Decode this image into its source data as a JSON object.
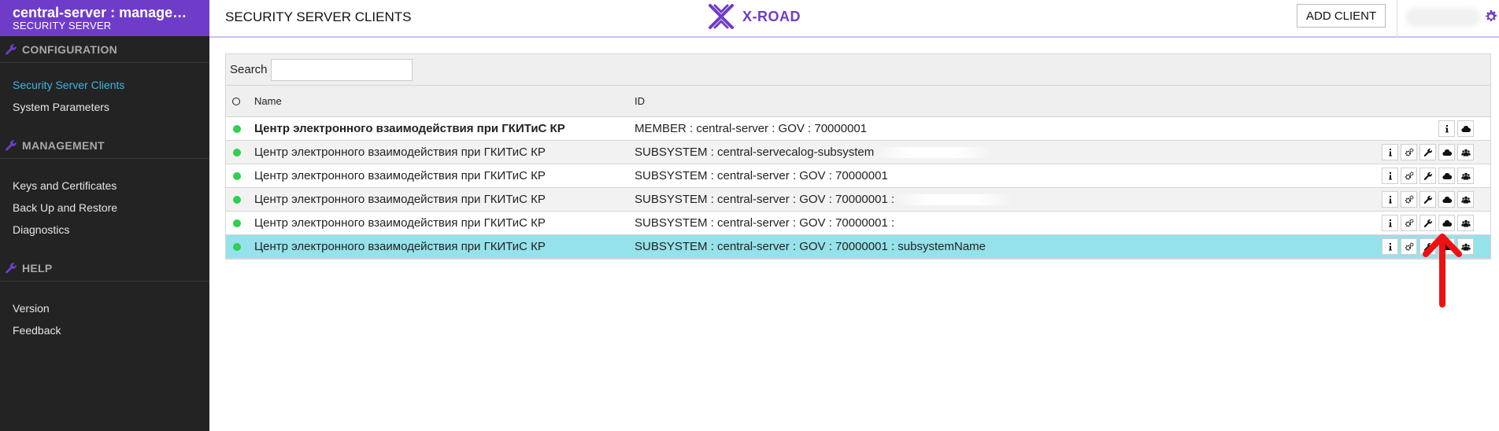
{
  "sidebar": {
    "title": "central-server : management...",
    "subtitle": "SECURITY SERVER",
    "sections": [
      {
        "label": "CONFIGURATION",
        "items": [
          "Security Server Clients",
          "System Parameters"
        ]
      },
      {
        "label": "MANAGEMENT",
        "items": [
          "Keys and Certificates",
          "Back Up and Restore",
          "Diagnostics"
        ]
      },
      {
        "label": "HELP",
        "items": [
          "Version",
          "Feedback"
        ]
      }
    ],
    "active_item": "Security Server Clients"
  },
  "header": {
    "title": "SECURITY SERVER CLIENTS",
    "logo_text": "X-ROAD",
    "add_client_label": "ADD CLIENT"
  },
  "table": {
    "search_label": "Search",
    "search_value": "",
    "columns": {
      "name": "Name",
      "id": "ID"
    },
    "rows": [
      {
        "name": "Центр электронного взаимодействия при ГКИТиС КР",
        "id": "MEMBER : central-server : GOV : 70000001",
        "bold": true,
        "selected": false,
        "status": "green",
        "actions": [
          "info-icon",
          "cloud-icon"
        ]
      },
      {
        "name": "Центр электронного взаимодействия при ГКИТиС КР",
        "id": "SUBSYSTEM : central-servecalog-subsystem",
        "bold": false,
        "selected": false,
        "status": "green",
        "actions": [
          "info-icon",
          "cogs-icon",
          "wrench-icon",
          "cloud-icon",
          "users-icon"
        ]
      },
      {
        "name": "Центр электронного взаимодействия при ГКИТиС КР",
        "id": "SUBSYSTEM : central-server : GOV : 70000001",
        "bold": false,
        "selected": false,
        "status": "green",
        "actions": [
          "info-icon",
          "cogs-icon",
          "wrench-icon",
          "cloud-icon",
          "users-icon"
        ]
      },
      {
        "name": "Центр электронного взаимодействия при ГКИТиС КР",
        "id": "SUBSYSTEM : central-server : GOV : 70000001 :",
        "bold": false,
        "selected": false,
        "status": "green",
        "actions": [
          "info-icon",
          "cogs-icon",
          "wrench-icon",
          "cloud-icon",
          "users-icon"
        ]
      },
      {
        "name": "Центр электронного взаимодействия при ГКИТиС КР",
        "id": "SUBSYSTEM : central-server : GOV : 70000001 :",
        "bold": false,
        "selected": false,
        "status": "green",
        "actions": [
          "info-icon",
          "cogs-icon",
          "wrench-icon",
          "cloud-icon",
          "users-icon"
        ]
      },
      {
        "name": "Центр электронного взаимодействия при ГКИТиС КР",
        "id": "SUBSYSTEM : central-server : GOV : 70000001 : subsystemName",
        "bold": false,
        "selected": true,
        "status": "green",
        "actions": [
          "info-icon",
          "cogs-icon",
          "wrench-icon",
          "cloud-icon",
          "users-icon"
        ]
      }
    ]
  },
  "colors": {
    "brand": "#6f3cc9",
    "sidebar_bg": "#232323",
    "active_link": "#3fb5df",
    "selected_row": "#96e2ea",
    "status_green": "#2fcf4f",
    "annotation_arrow": "#ee1111"
  }
}
